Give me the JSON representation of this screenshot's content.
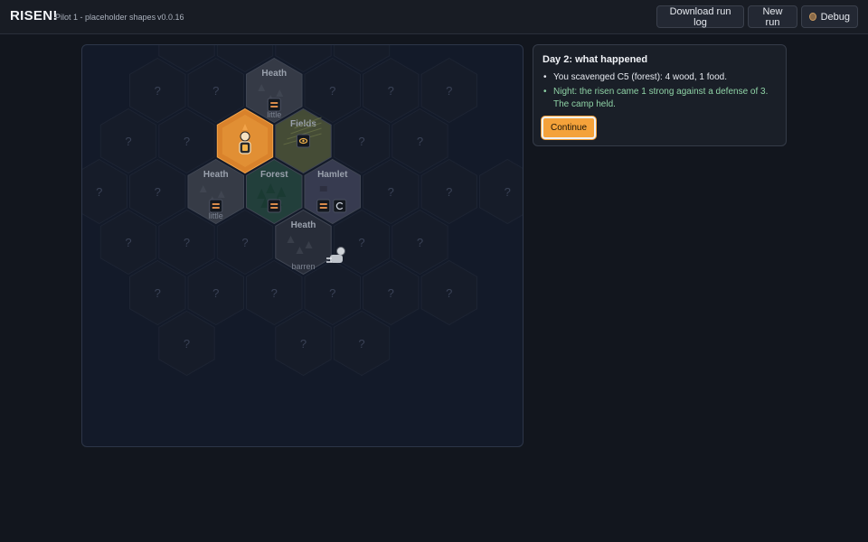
{
  "header": {
    "title": "RISEN!",
    "subtitle": "Pilot 1 - placeholder shapes",
    "version": "v0.0.16",
    "buttons": {
      "download": "Download run log",
      "new_run": "New run",
      "debug": "Debug"
    }
  },
  "map": {
    "unknown_label": "?",
    "tiles": [
      {
        "col": -2,
        "row": 0,
        "state": "unknown"
      },
      {
        "col": -1,
        "row": -1,
        "state": "unknown"
      },
      {
        "col": 0,
        "row": 0,
        "state": "unknown"
      },
      {
        "col": 1,
        "row": 0,
        "state": "unknown"
      },
      {
        "col": -3,
        "row": 1,
        "state": "unknown"
      },
      {
        "col": -2,
        "row": 1,
        "state": "unknown"
      },
      {
        "col": -1,
        "row": 0,
        "state": "unknown"
      },
      {
        "col": 0,
        "row": 1,
        "state": "unknown"
      },
      {
        "col": 1,
        "row": 1,
        "state": "unknown"
      },
      {
        "col": 2,
        "row": 1,
        "state": "unknown"
      },
      {
        "col": -3,
        "row": 2,
        "state": "unknown"
      },
      {
        "col": -2,
        "row": 2,
        "state": "unknown"
      },
      {
        "col": -1,
        "row": 1,
        "state": "known",
        "terrain": "heath",
        "name": "Heath",
        "note": "little",
        "badges": [
          "stock"
        ]
      },
      {
        "col": 0,
        "row": 2,
        "state": "known",
        "terrain": "fields",
        "name": "Fields",
        "note": "",
        "badges": [
          "eye"
        ]
      },
      {
        "col": 1,
        "row": 2,
        "state": "unknown"
      },
      {
        "col": 2,
        "row": 2,
        "state": "unknown"
      },
      {
        "col": -4,
        "row": 3,
        "state": "unknown"
      },
      {
        "col": -3,
        "row": 3,
        "state": "unknown"
      },
      {
        "col": -2,
        "row": 3,
        "state": "known",
        "terrain": "heath",
        "name": "Heath",
        "note": "little",
        "badges": [
          "stock"
        ]
      },
      {
        "col": -1,
        "row": 2,
        "state": "camp",
        "terrain": "camp",
        "name": "",
        "note": "",
        "badges": []
      },
      {
        "col": 0,
        "row": 3,
        "state": "known",
        "terrain": "hamlet",
        "name": "Hamlet",
        "note": "",
        "badges": [
          "stock",
          "swirl"
        ]
      },
      {
        "col": 1,
        "row": 3,
        "state": "unknown"
      },
      {
        "col": 2,
        "row": 3,
        "state": "unknown"
      },
      {
        "col": 3,
        "row": 3,
        "state": "unknown"
      },
      {
        "col": -3,
        "row": 4,
        "state": "unknown"
      },
      {
        "col": -2,
        "row": 4,
        "state": "unknown"
      },
      {
        "col": -1,
        "row": 3,
        "state": "known",
        "terrain": "forest",
        "name": "Forest",
        "note": "",
        "badges": [
          "stock"
        ]
      },
      {
        "col": 0,
        "row": 4,
        "state": "known",
        "terrain": "heath-dark",
        "name": "Heath",
        "note": "barren",
        "badges": []
      },
      {
        "col": 1,
        "row": 4,
        "state": "unknown"
      },
      {
        "col": 2,
        "row": 4,
        "state": "unknown"
      },
      {
        "col": -3,
        "row": 5,
        "state": "unknown"
      },
      {
        "col": -2,
        "row": 5,
        "state": "unknown"
      },
      {
        "col": -1,
        "row": 4,
        "state": "unknown"
      },
      {
        "col": 0,
        "row": 5,
        "state": "unknown"
      },
      {
        "col": 1,
        "row": 5,
        "state": "unknown"
      },
      {
        "col": 2,
        "row": 5,
        "state": "unknown"
      },
      {
        "col": -2,
        "row": 6,
        "state": "unknown"
      },
      {
        "col": -1,
        "row": 5,
        "state": "unknown"
      },
      {
        "col": 0,
        "row": 6,
        "state": "unknown"
      },
      {
        "col": 1,
        "row": 6,
        "state": "unknown"
      }
    ]
  },
  "panel": {
    "title": "Day 2: what happened",
    "entries": [
      {
        "text": "You scavenged C5 (forest): 4 wood, 1 food.",
        "kind": "normal"
      },
      {
        "text": "Night: the risen came 1 strong against a defense of 3. The camp held.",
        "kind": "night"
      }
    ],
    "continue_label": "Continue"
  },
  "colors": {
    "accent": "#f4a23a",
    "night_text": "#8fd3a6",
    "heath": "#3a3f4a",
    "fields": "#4b5238",
    "hamlet": "#3b3f55",
    "forest": "#24443d",
    "camp": "#d9822b"
  },
  "icons": {
    "player": "survivor-icon",
    "risen": "risen-icon",
    "stock": "stockpile-icon",
    "eye": "eye-icon",
    "swirl": "swirl-icon",
    "debug": "bug-icon"
  }
}
